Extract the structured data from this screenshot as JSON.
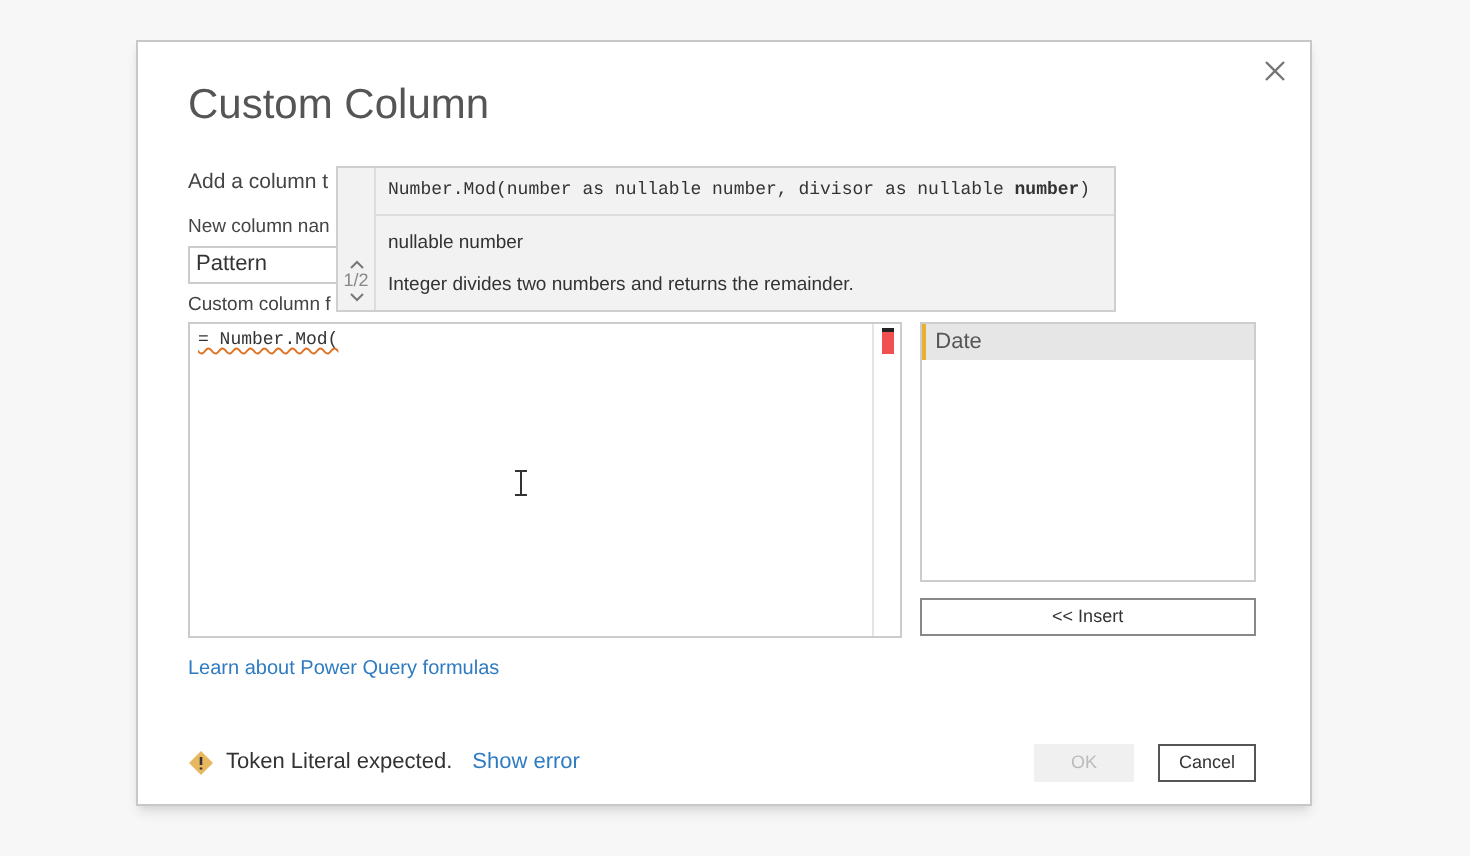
{
  "dialog": {
    "title": "Custom Column",
    "description": "Add a column t",
    "name_label": "New column nan",
    "name_value": "Pattern",
    "formula_label": "Custom column f",
    "formula": "= Number.Mod(",
    "error_marker": true
  },
  "tooltip": {
    "signature": "Number.Mod(number as nullable number, divisor as nullable **number**)",
    "page": "1/2",
    "type": "nullable number",
    "summary": "Integer divides two numbers and returns the remainder."
  },
  "columns": [
    {
      "name": "Date",
      "selected": true
    }
  ],
  "insert_button": "<< Insert",
  "link": "Learn about Power Query formulas",
  "status": {
    "message": "Token Literal expected.",
    "link": "Show error"
  },
  "buttons": [
    {
      "label": "OK",
      "disabled": true
    },
    {
      "label": "Cancel",
      "disabled": false
    }
  ]
}
